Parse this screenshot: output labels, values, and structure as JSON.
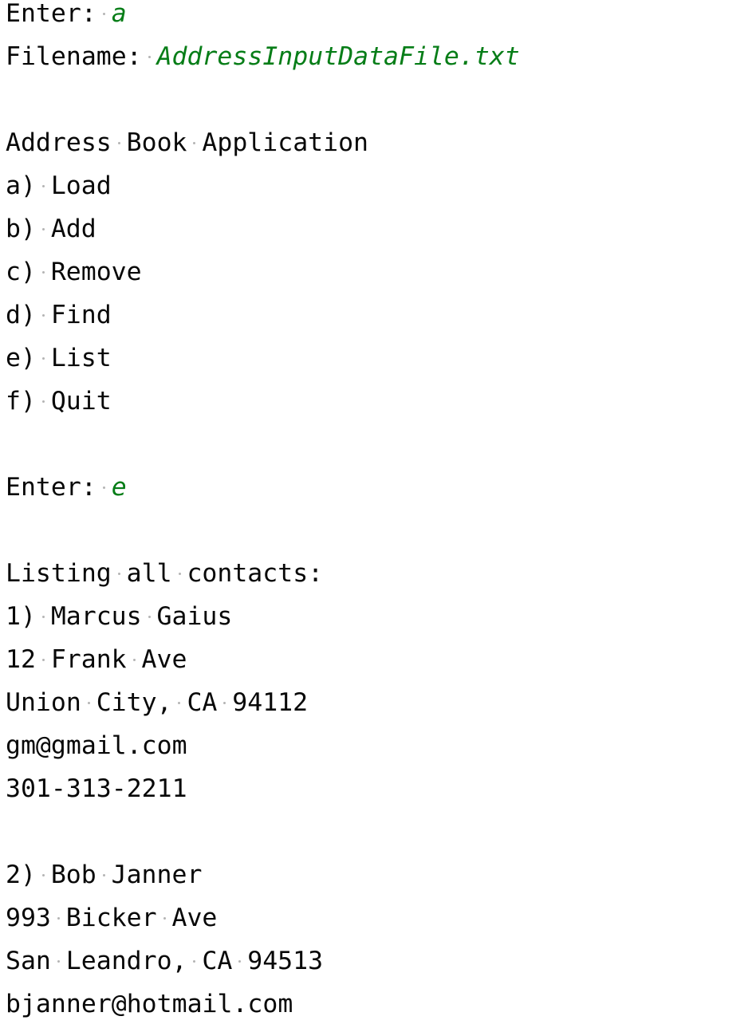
{
  "lines": [
    {
      "text": "Enter: ",
      "input": "a"
    },
    {
      "text": "Filename: ",
      "input": "AddressInputDataFile.txt"
    },
    {
      "text": ""
    },
    {
      "text": "Address Book Application"
    },
    {
      "text": "a) Load"
    },
    {
      "text": "b) Add"
    },
    {
      "text": "c) Remove"
    },
    {
      "text": "d) Find"
    },
    {
      "text": "e) List"
    },
    {
      "text": "f) Quit"
    },
    {
      "text": ""
    },
    {
      "text": "Enter: ",
      "input": "e"
    },
    {
      "text": ""
    },
    {
      "text": "Listing all contacts:"
    },
    {
      "text": "1) Marcus Gaius"
    },
    {
      "text": "12 Frank Ave"
    },
    {
      "text": "Union City, CA 94112"
    },
    {
      "text": "gm@gmail.com"
    },
    {
      "text": "301-313-2211"
    },
    {
      "text": ""
    },
    {
      "text": "2) Bob Janner"
    },
    {
      "text": "993 Bicker Ave"
    },
    {
      "text": "San Leandro, CA 94513"
    },
    {
      "text": "bjanner@hotmail.com"
    }
  ],
  "colors": {
    "input": "#067d17",
    "text": "#080808",
    "whitespace_dot": "#b4b4b4"
  }
}
